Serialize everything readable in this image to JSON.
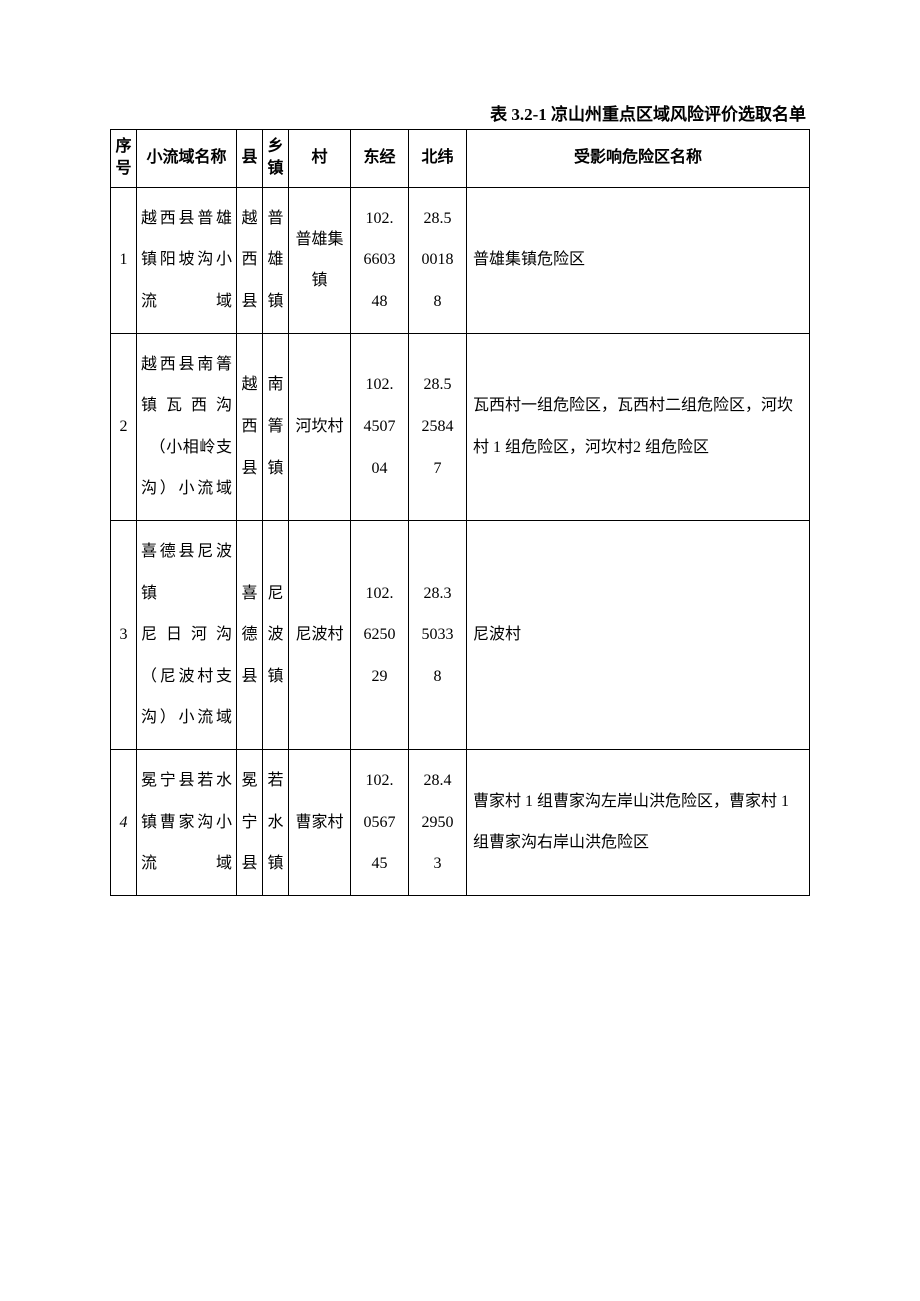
{
  "title": "表 3.2-1 凉山州重点区域风险评价选取名单",
  "headers": {
    "seq": "序号",
    "watershed": "小流域名称",
    "county": "县",
    "town": "乡镇",
    "village": "村",
    "lon": "东经",
    "lat": "北纬",
    "risk": "受影响危险区名称"
  },
  "rows": [
    {
      "seq": "1",
      "watershed": "越西县普雄镇阳坡沟小流域",
      "county": "越西县",
      "town": "普雄镇",
      "village": "普雄集镇",
      "lon": "102.660348",
      "lat": "28.500188",
      "risk": "普雄集镇危险区"
    },
    {
      "seq": "2",
      "watershed": "越西县南箐镇瓦西沟\n　（小相岭支沟）小流域",
      "county": "越西县",
      "town": "南箐镇",
      "village": "河坎村",
      "lon": "102.450704",
      "lat": "28.525847",
      "risk": "瓦西村一组危险区，瓦西村二组危险区，河坎村 1 组危险区，河坎村2 组危险区"
    },
    {
      "seq": "3",
      "watershed": "喜德县尼波镇\n尼日河沟（尼波村支沟）小流域",
      "county": "喜德县",
      "town": "尼波镇",
      "village": "尼波村",
      "lon": "102.625029",
      "lat": "28.350338",
      "risk": "尼波村"
    },
    {
      "seq": "4",
      "seq_italic": true,
      "watershed": "冕宁县若水镇曹家沟小流域",
      "county": "冕宁县",
      "town": "若水镇",
      "village": "曹家村",
      "lon": "102.056745",
      "lat": "28.429503",
      "risk": "曹家村 1 组曹家沟左岸山洪危险区，曹家村 1 组曹家沟右岸山洪危险区"
    }
  ]
}
